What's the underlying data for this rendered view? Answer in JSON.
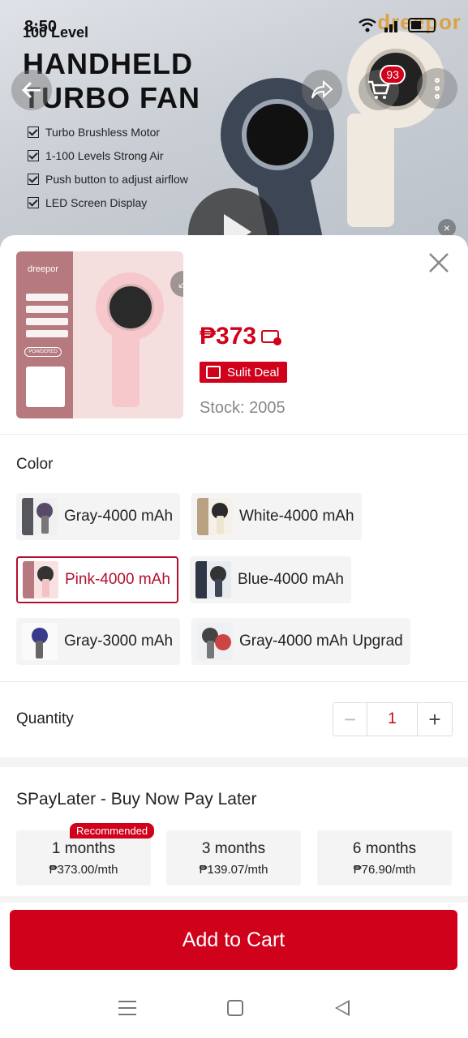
{
  "status_bar": {
    "time": "8:50",
    "battery": "29"
  },
  "hero": {
    "brand": "dreepor",
    "level_text": "100 Level",
    "title_line1": "HANDHELD",
    "title_line2": "TURBO FAN",
    "features": [
      "Turbo Brushless Motor",
      "1-100 Levels Strong Air",
      "Push button to adjust airflow",
      "LED Screen Display"
    ],
    "cart_count": "93"
  },
  "product": {
    "thumb_brand": "dreepor",
    "thumb_badge": "POWDERED",
    "price": "₱373",
    "deal_label": "Sulit Deal",
    "stock": "Stock: 2005"
  },
  "color_section": {
    "label": "Color",
    "options": [
      {
        "label": "Gray-4000 mAh",
        "selected": false
      },
      {
        "label": "White-4000 mAh",
        "selected": false
      },
      {
        "label": "Pink-4000 mAh",
        "selected": true
      },
      {
        "label": "Blue-4000 mAh",
        "selected": false
      },
      {
        "label": "Gray-3000 mAh",
        "selected": false
      },
      {
        "label": "Gray-4000 mAh Upgrad",
        "selected": false
      }
    ]
  },
  "quantity": {
    "label": "Quantity",
    "minus": "−",
    "value": "1",
    "plus": "+"
  },
  "spaylater": {
    "title": "SPayLater - Buy Now Pay Later",
    "recommended_badge": "Recommended",
    "plans": [
      {
        "term": "1 months",
        "amount": "₱373.00/mth"
      },
      {
        "term": "3 months",
        "amount": "₱139.07/mth"
      },
      {
        "term": "6 months",
        "amount": "₱76.90/mth"
      }
    ]
  },
  "cta": {
    "label": "Add to Cart"
  },
  "colors": {
    "accent": "#d0011b",
    "selected_border": "#b40f2f"
  }
}
